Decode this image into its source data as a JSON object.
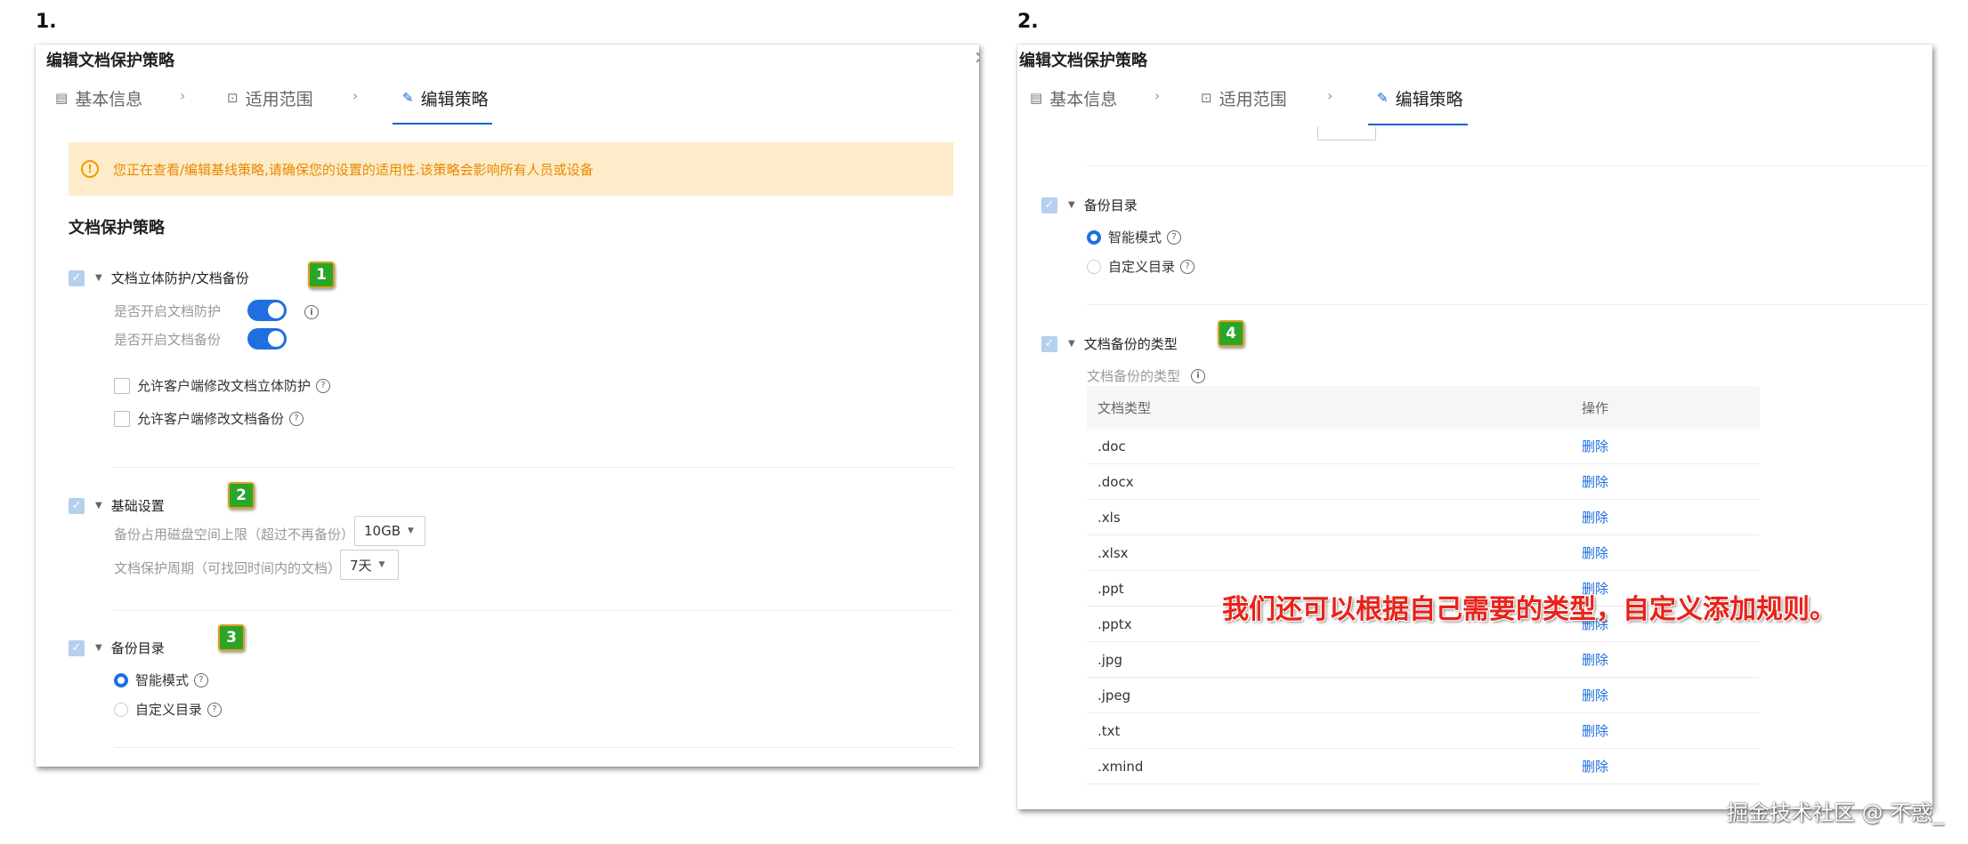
{
  "panel1": {
    "step": "1.",
    "title": "编辑文档保护策略",
    "close": "×",
    "tabs": [
      {
        "label": "基本信息"
      },
      {
        "label": "适用范围"
      },
      {
        "label": "编辑策略"
      }
    ],
    "tab_separator": "›",
    "warning": "您正在查看/编辑基线策略,请确保您的设置的适用性.该策略会影响所有人员或设备",
    "section_title": "文档保护策略",
    "doc_protect": {
      "header": "文档立体防护/文档备份",
      "badge": "1",
      "enable_protection_label": "是否开启文档防护",
      "enable_backup_label": "是否开启文档备份",
      "allow_client_protect": "允许客户端修改文档立体防护",
      "allow_client_backup": "允许客户端修改文档备份"
    },
    "basic": {
      "header": "基础设置",
      "badge": "2",
      "disk_limit_label": "备份占用磁盘空间上限（超过不再备份）",
      "disk_limit_value": "10GB",
      "period_label": "文档保护周期（可找回时间内的文档）",
      "period_value": "7天"
    },
    "backup_dir": {
      "header": "备份目录",
      "badge": "3",
      "smart_mode": "智能模式",
      "custom_dir": "自定义目录"
    }
  },
  "panel2": {
    "step": "2.",
    "title": "编辑文档保护策略",
    "tabs": [
      {
        "label": "基本信息"
      },
      {
        "label": "适用范围"
      },
      {
        "label": "编辑策略"
      }
    ],
    "tab_separator": "›",
    "backup_dir": {
      "header": "备份目录",
      "smart_mode": "智能模式",
      "custom_dir": "自定义目录"
    },
    "types": {
      "header": "文档备份的类型",
      "badge": "4",
      "sub_label": "文档备份的类型",
      "columns": [
        "文档类型",
        "操作"
      ],
      "rows": [
        {
          "type": ".doc",
          "op": "删除"
        },
        {
          "type": ".docx",
          "op": "删除"
        },
        {
          "type": ".xls",
          "op": "删除"
        },
        {
          "type": ".xlsx",
          "op": "删除"
        },
        {
          "type": ".ppt",
          "op": "删除"
        },
        {
          "type": ".pptx",
          "op": "删除"
        },
        {
          "type": ".jpg",
          "op": "删除"
        },
        {
          "type": ".jpeg",
          "op": "删除"
        },
        {
          "type": ".txt",
          "op": "删除"
        },
        {
          "type": ".xmind",
          "op": "删除"
        }
      ]
    },
    "annotation": "我们还可以根据自己需要的类型，自定义添加规则。"
  },
  "watermark": "掘金技术社区 @ 不惑_",
  "colors": {
    "accent": "#1f6fe0",
    "warning_bg": "#fdecca",
    "warning_text": "#e88900",
    "badge": "#2aa52a",
    "annotation": "#e8231a"
  }
}
